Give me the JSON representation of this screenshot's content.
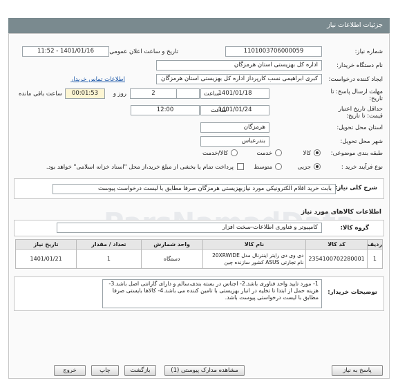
{
  "header": {
    "title": "جزئیات اطلاعات نیاز"
  },
  "fields": {
    "need_number_label": "شماره نیاز:",
    "need_number": "1101003706000059",
    "announce_label": "تاریخ و ساعت اعلان عمومی:",
    "announce_value": "1401/01/16 - 11:52",
    "buyer_org_label": "نام دستگاه خریدار:",
    "buyer_org": "اداره کل بهزیستی استان هرمزگان",
    "creator_label": "ایجاد کننده درخواست:",
    "creator": "کبری  ابراهیمی نسب کارپرداز اداره کل بهزیستی استان هرمزگان",
    "contact_link": "اطلاعات تماس خریدار",
    "reply_deadline_label": "مهلت ارسال پاسخ: تا تاریخ:",
    "reply_date": "1401/01/18",
    "time_label": "ساعت",
    "reply_time": "12:00",
    "days": "2",
    "days_label": "روز و",
    "remaining": "00:01:53",
    "remaining_label": "ساعت باقی مانده",
    "price_validity_label": "حداقل تاریخ اعتبار قیمت: تا تاریخ:",
    "price_date": "1401/01/24",
    "price_time": "12:00",
    "province_label": "استان محل تحویل:",
    "province": "هرمزگان",
    "city_label": "شهر محل تحویل:",
    "city": "بندرعباس",
    "category_label": "طبقه بندی موضوعی:",
    "category_options": [
      "کالا",
      "خدمت",
      "کالا/خدمت"
    ],
    "process_label": "نوع فرآیند خرید :",
    "process_options": [
      "جزیی",
      "متوسط"
    ],
    "payment_note": "پرداخت تمام یا بخشی از مبلغ خرید،از محل \"اسناد خزانه اسلامی\" خواهد بود."
  },
  "summary": {
    "label": "شرح کلی نیاز:",
    "text": "بابت خرید اقلام  الکترونیکی مورد نیازبهزیستی هرمزگان صرفا مطابق با لیست درخواست پیوست"
  },
  "goods": {
    "section_title": "اطلاعات کالاهای مورد نیاز",
    "group_label": "گروه کالا:",
    "group_value": "کامپیوتر و فناوری اطلاعات-سخت افزار",
    "columns": [
      "ردیف",
      "کد کالا",
      "نام کالا",
      "واحد شمارش",
      "تعداد / مقدار",
      "تاریخ نیاز"
    ],
    "rows": [
      {
        "index": "1",
        "code": "2354100702280001",
        "name": "دی وی دی رایتر اینترنال مدل 20XRWIDE نام تجارتی ASUS کشور سازنده چین",
        "unit": "دستگاه",
        "qty": "1",
        "date": "1401/01/21"
      }
    ]
  },
  "buyer_notes": {
    "label": "توضیحات خریدار:",
    "text": "1- مورد تایید واحد فناوری باشد.2- اجناس در بسته بندی،سالم و دارای گارانتی اصل باشد.3- هزینه حمل از ابتدا تا تخلیه در انبار بهزیستی با تامین کننده می باشد.4- کالاها بایستی صرفا مطابق با لیست درخواستی پیوست باشد."
  },
  "buttons": {
    "reply": "پاسخ به نیاز",
    "attachments": "مشاهده مدارک پیوستی (1)",
    "back": "بازگشت",
    "print": "چاپ",
    "exit": "خروج"
  },
  "watermark": "ParsNamadData"
}
